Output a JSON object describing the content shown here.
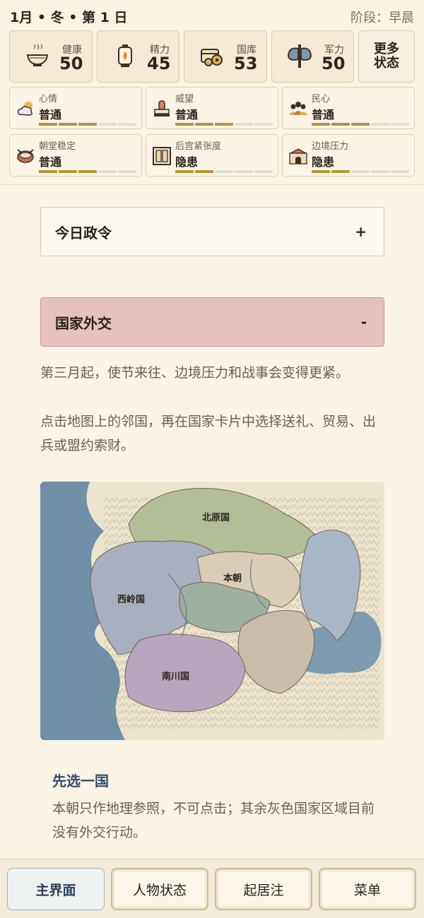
{
  "header": {
    "date": "1月 • 冬 • 第 1 日",
    "phase": "阶段：早晨"
  },
  "stats": [
    {
      "label": "健康",
      "value": "50",
      "icon": "rice-bowl-icon"
    },
    {
      "label": "精力",
      "value": "45",
      "icon": "lantern-icon"
    },
    {
      "label": "国库",
      "value": "53",
      "icon": "treasury-chest-icon"
    },
    {
      "label": "军力",
      "value": "50",
      "icon": "battle-axe-icon"
    }
  ],
  "more_status": "更多状态",
  "moods": [
    {
      "label": "心情",
      "value": "普通",
      "icon": "cloud-sun-icon",
      "level": 3,
      "of": 5
    },
    {
      "label": "威望",
      "value": "普通",
      "icon": "seal-stamp-icon",
      "level": 3,
      "of": 5
    },
    {
      "label": "民心",
      "value": "普通",
      "icon": "people-icon",
      "level": 3,
      "of": 5
    },
    {
      "label": "朝堂稳定",
      "value": "普通",
      "icon": "court-drum-icon",
      "level": 3,
      "of": 5
    },
    {
      "label": "后宫紧张度",
      "value": "隐患",
      "icon": "palace-door-icon",
      "level": 2,
      "of": 5
    },
    {
      "label": "边境压力",
      "value": "隐患",
      "icon": "fortress-icon",
      "level": 2,
      "of": 5
    }
  ],
  "panels": {
    "today_policy": {
      "title": "今日政令",
      "toggle": "+"
    },
    "diplomacy": {
      "title": "国家外交",
      "toggle": "-"
    }
  },
  "diplomacy_text": {
    "line1": "第三月起，使节来往、边境压力和战事会变得更紧。",
    "line2": "点击地图上的邻国，再在国家卡片中选择送礼、贸易、出兵或盟约索财。"
  },
  "map": {
    "regions": [
      "北原国",
      "本朝",
      "西岭国",
      "南川国"
    ],
    "colors": {
      "north": "#b3bd98",
      "home": "#d9cdb7",
      "west": "#a9afbf",
      "south": "#b8a6bf",
      "sea": "#6f8fa6"
    }
  },
  "selection": {
    "title": "先选一国",
    "desc": "本朝只作地理参照，不可点击；其余灰色国家区域目前没有外交行动。"
  },
  "nav": [
    "主界面",
    "人物状态",
    "起居注",
    "菜单"
  ]
}
